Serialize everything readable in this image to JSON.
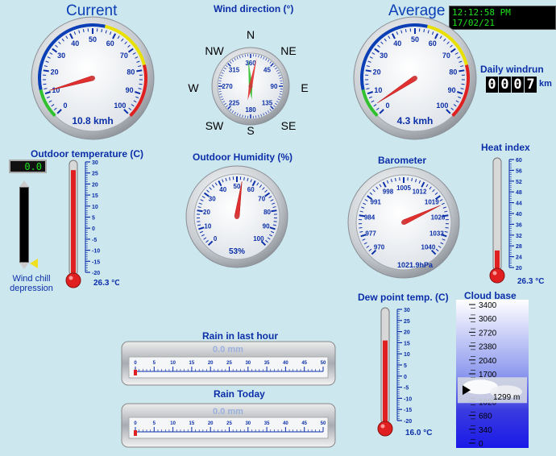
{
  "header": {
    "current_title": "Current",
    "average_title": "Average",
    "clock": "12:12:58 PM 17/02/21"
  },
  "wind_current": {
    "labels": [
      "0",
      "10",
      "20",
      "30",
      "40",
      "50",
      "60",
      "70",
      "80",
      "90",
      "100"
    ],
    "value": 10.8,
    "readout": "10.8 kmh"
  },
  "wind_average": {
    "labels": [
      "0",
      "10",
      "20",
      "30",
      "40",
      "50",
      "60",
      "70",
      "80",
      "90",
      "100"
    ],
    "value": 4.3,
    "readout": "4.3 kmh"
  },
  "wind_direction": {
    "title": "Wind direction (°)",
    "compass": {
      "N": "N",
      "NE": "NE",
      "E": "E",
      "SE": "SE",
      "S": "S",
      "SW": "SW",
      "W": "W",
      "NW": "NW"
    },
    "labels": [
      "360",
      "45",
      "90",
      "135",
      "180",
      "225",
      "270",
      "315"
    ],
    "current_deg": 12,
    "average_deg": 355
  },
  "windrun": {
    "title": "Daily windrun",
    "digits": [
      "0",
      "0",
      "0",
      "7"
    ],
    "unit": "km"
  },
  "outdoor_temp": {
    "title": "Outdoor temperature (C)",
    "display": "0.0",
    "readout": "26.3 °C",
    "scale": [
      "30",
      "25",
      "20",
      "15",
      "10",
      "5",
      "0",
      "-5",
      "-10",
      "-15",
      "-20"
    ],
    "value": 26.3
  },
  "wind_chill": {
    "label": "Wind chill depression"
  },
  "humidity": {
    "title": "Outdoor Humidity (%)",
    "labels": [
      "0",
      "10",
      "20",
      "30",
      "40",
      "50",
      "60",
      "70",
      "80",
      "90",
      "100"
    ],
    "value": 53,
    "readout": "53%"
  },
  "barometer": {
    "title": "Barometer",
    "labels": [
      "970",
      "977",
      "984",
      "991",
      "998",
      "1005",
      "1012",
      "1019",
      "1026",
      "1033",
      "1040"
    ],
    "value": 1021.9,
    "readout": "1021.9hPa"
  },
  "heat_index": {
    "title": "Heat index",
    "scale": [
      "60",
      "56",
      "52",
      "48",
      "44",
      "40",
      "36",
      "32",
      "28",
      "24",
      "20"
    ],
    "value": 26.3,
    "readout": "26.3 °C"
  },
  "dew_point": {
    "title": "Dew point temp. (C)",
    "scale": [
      "30",
      "25",
      "20",
      "15",
      "10",
      "5",
      "0",
      "-5",
      "-10",
      "-15",
      "-20"
    ],
    "value": 16.0,
    "readout": "16.0 °C"
  },
  "cloud_base": {
    "title": "Cloud base",
    "scale": [
      "3400",
      "3060",
      "2720",
      "2380",
      "2040",
      "1700",
      "1360",
      "1020",
      "680",
      "340",
      "0"
    ],
    "value": 1299,
    "readout": "1299 m"
  },
  "rain_hour": {
    "title": "Rain in last hour",
    "readout": "0.0 mm",
    "scale": [
      "0",
      "5",
      "10",
      "15",
      "20",
      "25",
      "30",
      "35",
      "40",
      "45",
      "50"
    ],
    "value": 0
  },
  "rain_today": {
    "title": "Rain Today",
    "readout": "0.0 mm",
    "scale": [
      "0",
      "5",
      "10",
      "15",
      "20",
      "25",
      "30",
      "35",
      "40",
      "45",
      "50"
    ],
    "value": 0
  },
  "colors": {
    "label_blue": "#0b2fa8",
    "needle": "#e03030",
    "mercury": "#e02020"
  }
}
